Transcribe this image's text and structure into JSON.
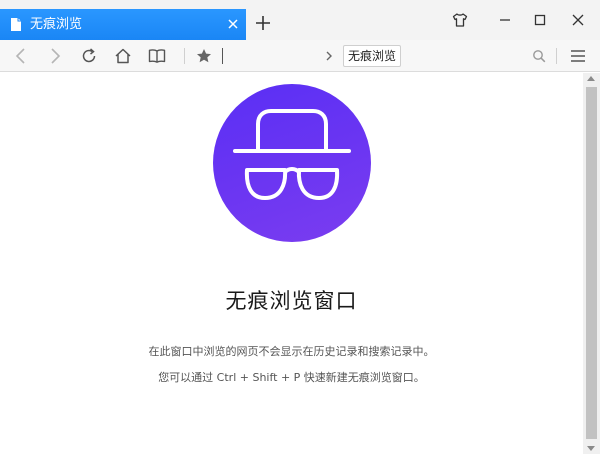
{
  "tab": {
    "title": "无痕浏览"
  },
  "toolbar": {
    "search_engine_label": "无痕浏览"
  },
  "page": {
    "heading": "无痕浏览窗口",
    "description_line1": "在此窗口中浏览的网页不会显示在历史记录和搜索记录中。",
    "description_line2": "您可以通过 Ctrl + Shift + P 快速新建无痕浏览窗口。"
  },
  "icons": {
    "tab": "page-icon",
    "tab_close": "close-icon",
    "new_tab": "plus-icon",
    "skin": "tshirt-icon",
    "minimize": "minimize-icon",
    "maximize": "maximize-icon",
    "close_window": "close-icon",
    "back": "arrow-left-icon",
    "forward": "arrow-right-icon",
    "refresh": "refresh-icon",
    "home": "home-icon",
    "reader": "book-icon",
    "bookmark": "star-icon",
    "dropdown": "chevron-right-icon",
    "search": "search-icon",
    "menu": "hamburger-icon",
    "incognito": "incognito-hat-glasses-icon"
  },
  "colors": {
    "tab_active": "#1e8bfa",
    "incognito_circle": "#6233f3"
  }
}
